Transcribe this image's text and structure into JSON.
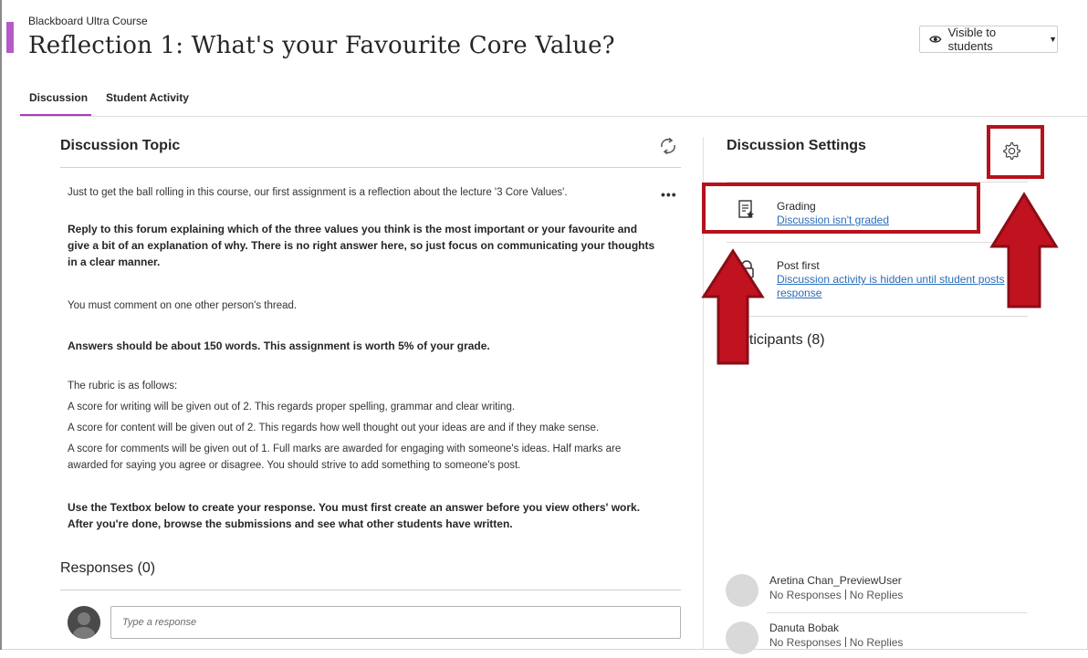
{
  "header": {
    "course_name": "Blackboard Ultra Course",
    "title": "Reflection 1: What's your Favourite Core Value?",
    "visibility_label": "Visible to students"
  },
  "tabs": [
    {
      "label": "Discussion",
      "active": true
    },
    {
      "label": "Student Activity",
      "active": false
    }
  ],
  "topic": {
    "title": "Discussion Topic",
    "more_label": "•••",
    "paragraphs": [
      "Just to get the ball rolling in this course, our first assignment is a reflection about the lecture '3 Core Values'.",
      "Reply to this forum explaining which of the three values you think is the most important or your favourite and give a bit of an explanation of why. There is no right answer here, so just focus on communicating your thoughts in a clear manner.",
      "You must comment on one other person's thread.",
      "Answers should be about 150 words. This assignment is worth 5% of your grade.",
      "The rubric is as follows:",
      "A score for writing will be given out of 2. This regards proper spelling, grammar and clear writing.",
      "A score for content will be given out of 2. This regards how well thought out your ideas are and if they make sense.",
      "A score for comments will be given out of 1. Full marks are awarded for engaging with someone's ideas. Half marks are awarded for saying you agree or disagree. You should strive to add something to someone's post.",
      "Use the Textbox below to create your response. You must first create an answer before you view others' work. After you're done, browse the submissions and see what other students have written."
    ]
  },
  "responses": {
    "title": "Responses (0)",
    "input_placeholder": "Type a response"
  },
  "settings": {
    "title": "Discussion Settings",
    "grading": {
      "label": "Grading",
      "link": "Discussion isn't graded"
    },
    "post_first": {
      "label": "Post first",
      "link": "Discussion activity is hidden until student posts response"
    }
  },
  "participants": {
    "title": "Participants (8)",
    "items": [
      {
        "name": "Aretina Chan_PreviewUser",
        "responses": "No Responses",
        "replies": "No Replies"
      },
      {
        "name": "Danuta Bobak",
        "responses": "No Responses",
        "replies": "No Replies"
      }
    ]
  },
  "colors": {
    "accent": "#a83cb8",
    "link": "#2a6db8",
    "annotation": "#b5121b"
  },
  "icons": [
    "eye-icon",
    "refresh-icon",
    "gear-icon",
    "grading-rubric-icon",
    "lock-icon",
    "avatar-icon",
    "arrow-up-annotation"
  ]
}
